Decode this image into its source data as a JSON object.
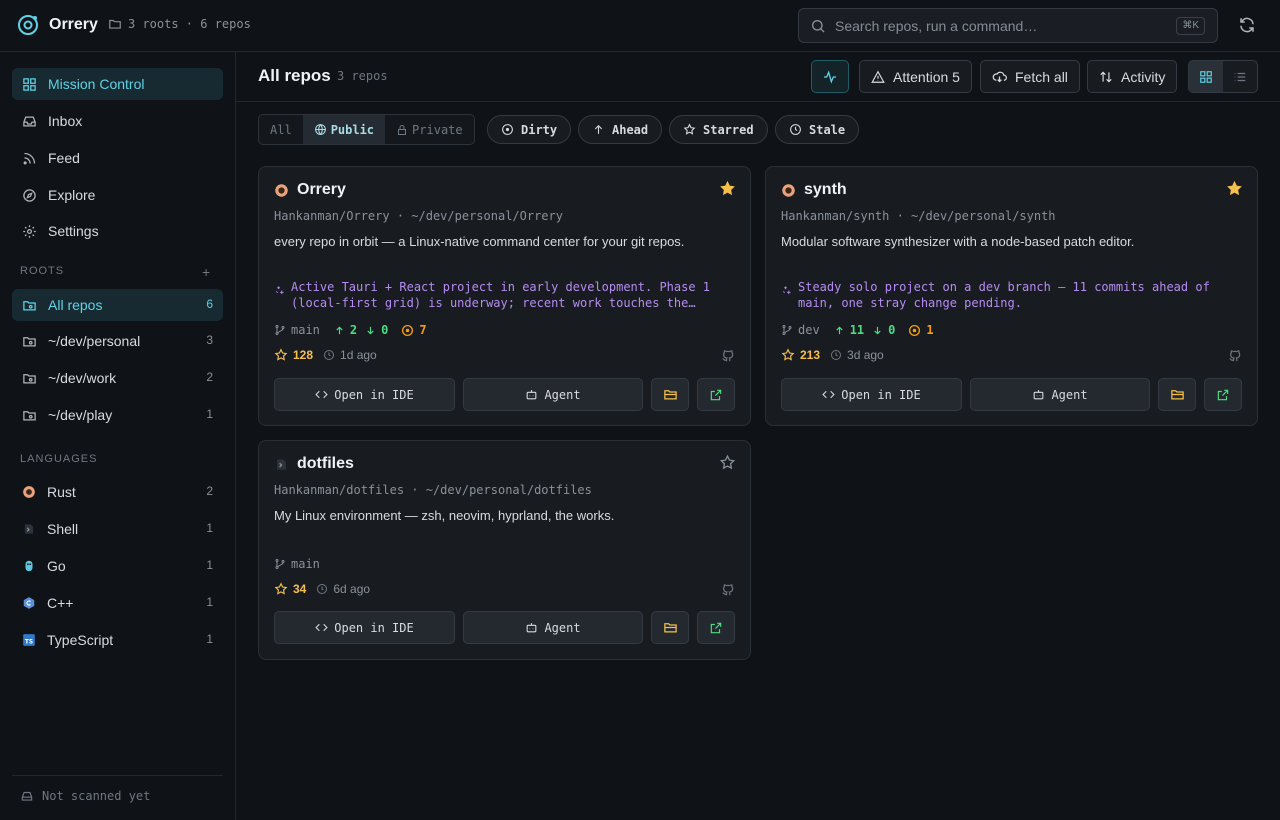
{
  "app": {
    "name": "Orrery",
    "roots_summary": "3 roots · 6 repos"
  },
  "search": {
    "placeholder": "Search repos, run a command…",
    "shortcut": "⌘K"
  },
  "sidebar": {
    "nav": [
      {
        "label": "Mission Control",
        "icon": "grid-icon",
        "active": true
      },
      {
        "label": "Inbox",
        "icon": "inbox-icon"
      },
      {
        "label": "Feed",
        "icon": "rss-icon"
      },
      {
        "label": "Explore",
        "icon": "compass-icon"
      },
      {
        "label": "Settings",
        "icon": "gear-icon"
      }
    ],
    "roots_title": "ROOTS",
    "roots": [
      {
        "label": "All repos",
        "count": "6",
        "active": true
      },
      {
        "label": "~/dev/personal",
        "count": "3"
      },
      {
        "label": "~/dev/work",
        "count": "2"
      },
      {
        "label": "~/dev/play",
        "count": "1"
      }
    ],
    "languages_title": "LANGUAGES",
    "languages": [
      {
        "label": "Rust",
        "count": "2",
        "icon": "rust-icon"
      },
      {
        "label": "Shell",
        "count": "1",
        "icon": "shell-icon"
      },
      {
        "label": "Go",
        "count": "1",
        "icon": "go-icon"
      },
      {
        "label": "C++",
        "count": "1",
        "icon": "cpp-icon"
      },
      {
        "label": "TypeScript",
        "count": "1",
        "icon": "typescript-icon"
      }
    ],
    "footer": "Not scanned yet"
  },
  "main": {
    "title": "All repos",
    "count": "3 repos",
    "actions": {
      "attention": "Attention 5",
      "fetch": "Fetch all",
      "activity": "Activity"
    }
  },
  "filters": {
    "visibility": [
      "All",
      "Public",
      "Private"
    ],
    "selected_visibility": "Public",
    "chips": [
      "Dirty",
      "Ahead",
      "Starred",
      "Stale"
    ]
  },
  "repos": [
    {
      "name": "Orrery",
      "path": "Hankanman/Orrery · ~/dev/personal/Orrery",
      "description": "every repo in orbit — a Linux-native command center for your git repos.",
      "summary": "Active Tauri + React project in early development. Phase 1 (local-first grid) is underway; recent work touches the…",
      "branch": "main",
      "ahead": "2",
      "behind": "0",
      "dirty": "7",
      "stars": "128",
      "updated": "1d ago",
      "starred": true,
      "language_icon": "rust-icon"
    },
    {
      "name": "synth",
      "path": "Hankanman/synth · ~/dev/personal/synth",
      "description": "Modular software synthesizer with a node-based patch editor.",
      "summary": "Steady solo project on a dev branch — 11 commits ahead of main, one stray change pending.",
      "branch": "dev",
      "ahead": "11",
      "behind": "0",
      "dirty": "1",
      "stars": "213",
      "updated": "3d ago",
      "starred": true,
      "language_icon": "rust-icon"
    },
    {
      "name": "dotfiles",
      "path": "Hankanman/dotfiles · ~/dev/personal/dotfiles",
      "description": "My Linux environment — zsh, neovim, hyprland, the works.",
      "branch": "main",
      "stars": "34",
      "updated": "6d ago",
      "starred": false,
      "language_icon": "shell-icon"
    }
  ],
  "card_buttons": {
    "open_ide": "Open in IDE",
    "agent": "Agent"
  },
  "colors": {
    "accent": "#5fd3e6",
    "ahead": "#4ade80",
    "dirty": "#f59e0b",
    "star": "#f5c04a",
    "ai_summary": "#b58cf0",
    "background": "#0f1216",
    "card": "#181c21"
  }
}
